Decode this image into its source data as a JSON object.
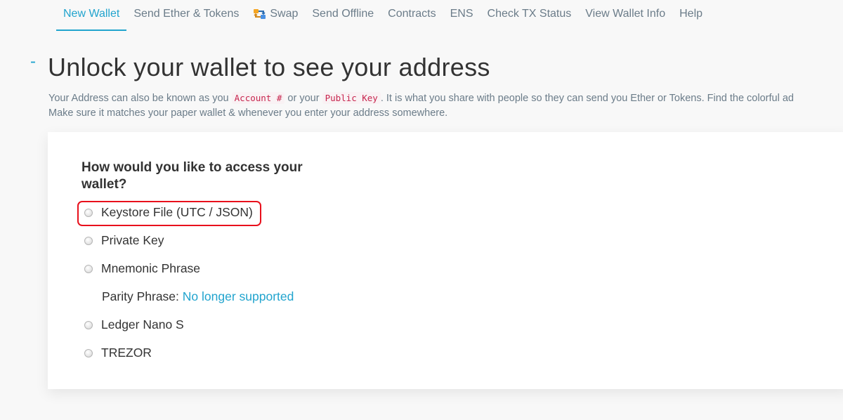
{
  "nav": {
    "tabs": [
      {
        "label": "New Wallet",
        "active": true
      },
      {
        "label": "Send Ether & Tokens"
      },
      {
        "label": "Swap",
        "icon": "swap-icon"
      },
      {
        "label": "Send Offline"
      },
      {
        "label": "Contracts"
      },
      {
        "label": "ENS"
      },
      {
        "label": "Check TX Status"
      },
      {
        "label": "View Wallet Info"
      },
      {
        "label": "Help"
      }
    ]
  },
  "header": {
    "toggle": "-",
    "title": "Unlock your wallet to see your address"
  },
  "intro": {
    "part1": "Your Address can also be known as you ",
    "tag1": "Account #",
    "part2": " or your ",
    "tag2": "Public Key",
    "part3": ". It is what you share with people so they can send you Ether or Tokens. Find the colorful ad",
    "line2": "Make sure it matches your paper wallet & whenever you enter your address somewhere."
  },
  "access": {
    "question": "How would you like to access your wallet?",
    "options": [
      {
        "label": "Keystore File (UTC / JSON)",
        "highlighted": true
      },
      {
        "label": "Private Key"
      },
      {
        "label": "Mnemonic Phrase"
      },
      {
        "label": "Ledger Nano S"
      },
      {
        "label": "TREZOR"
      }
    ],
    "parity_label": "Parity Phrase:",
    "parity_link": "No longer supported"
  },
  "colors": {
    "accent": "#21a4ce",
    "highlight": "#e8101c",
    "code_text": "#c7254e"
  }
}
